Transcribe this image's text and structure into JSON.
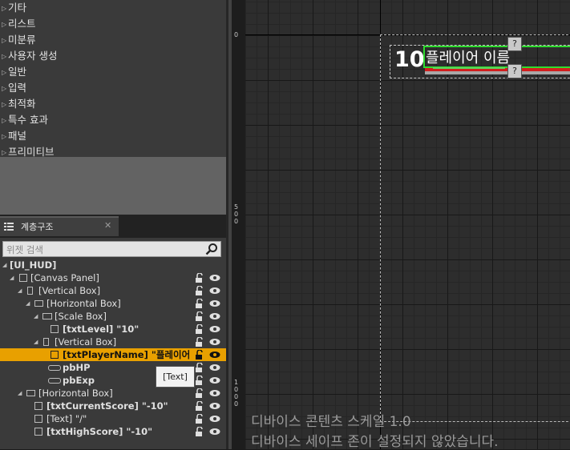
{
  "palette": {
    "items": [
      {
        "label": "기타"
      },
      {
        "label": "리스트"
      },
      {
        "label": "미분류"
      },
      {
        "label": "사용자 생성"
      },
      {
        "label": "일반"
      },
      {
        "label": "입력"
      },
      {
        "label": "최적화"
      },
      {
        "label": "특수 효과"
      },
      {
        "label": "패널"
      },
      {
        "label": "프리미티브"
      }
    ]
  },
  "hierarchy": {
    "tab_label": "계층구조",
    "tab_close": "✕",
    "search_placeholder": "위젯 검색",
    "root": "[UI_HUD]",
    "rows": [
      {
        "label": "[Canvas Panel]"
      },
      {
        "label": "[Vertical Box]"
      },
      {
        "label": "[Horizontal Box]"
      },
      {
        "label": "[Scale Box]"
      },
      {
        "label": "[txtLevel] \"10\""
      },
      {
        "label": "[Vertical Box]"
      },
      {
        "label": "[txtPlayerName] \"플레이어 이"
      },
      {
        "label": "pbHP"
      },
      {
        "label": "pbExp"
      },
      {
        "label": "[Horizontal Box]"
      },
      {
        "label": "[txtCurrentScore] \"-10\""
      },
      {
        "label": "[Text] \"/\""
      },
      {
        "label": "[txtHighScore] \"-10\""
      }
    ],
    "tooltip": "[Text]"
  },
  "canvas": {
    "ruler_labels": [
      "0",
      "5\n0\n0",
      "1\n0\n0\n0"
    ],
    "level_text": "10",
    "player_name": "플레이어 이름",
    "question_mark": "?",
    "dpi_scale_text": "디바이스 콘텐츠 스케일 1.0",
    "safe_zone_text": "디바이스 세이프 존이 설정되지 않았습니다."
  }
}
